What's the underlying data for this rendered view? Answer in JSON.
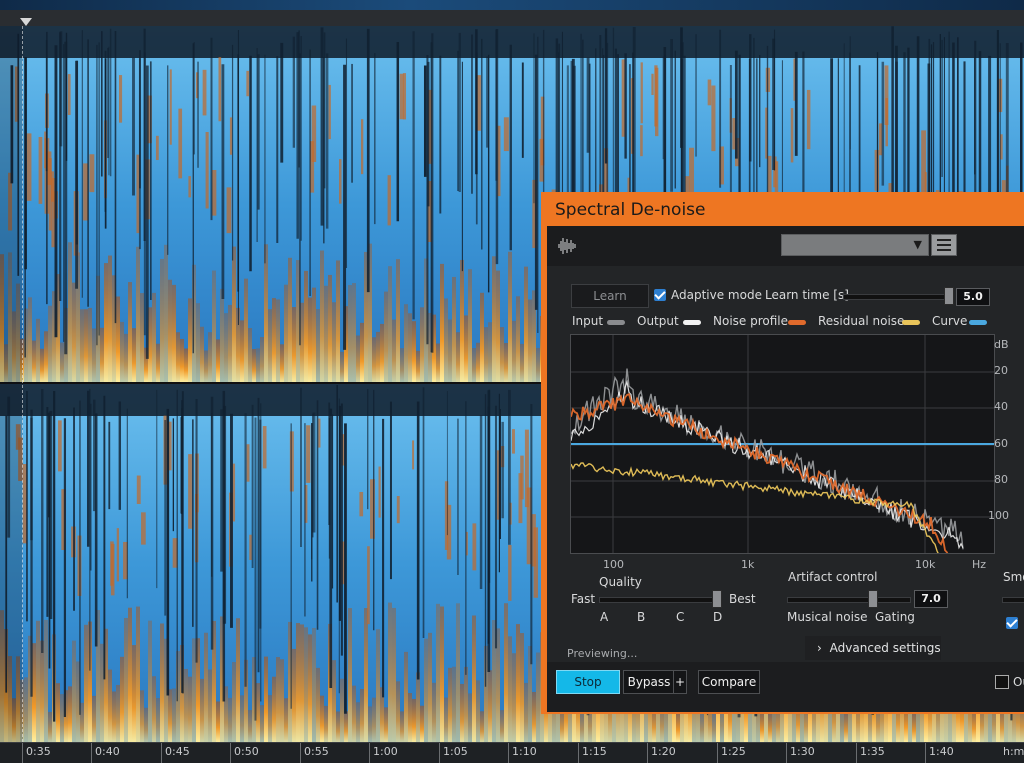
{
  "plugin": {
    "title": "Spectral De-noise",
    "learn_label": "Learn",
    "adaptive_label": "Adaptive mode",
    "learn_time_label": "Learn time [s]",
    "learn_time_value": "5.0",
    "legend": [
      {
        "label": "Input",
        "color": "#8a8c8f"
      },
      {
        "label": "Output",
        "color": "#f2f2f2"
      },
      {
        "label": "Noise profile",
        "color": "#e06a2c"
      },
      {
        "label": "Residual noise",
        "color": "#e9c45a"
      },
      {
        "label": "Curve",
        "color": "#4aa8e0"
      }
    ],
    "db_unit": "dB",
    "db_ticks": [
      "20",
      "40",
      "60",
      "80",
      "100"
    ],
    "hz_ticks": [
      "100",
      "1k",
      "10k",
      "Hz"
    ],
    "quality_label": "Quality",
    "fast_label": "Fast",
    "best_label": "Best",
    "quality_marks": [
      "A",
      "B",
      "C",
      "D"
    ],
    "artifact_label": "Artifact control",
    "artifact_value": "7.0",
    "musical_noise_label": "Musical noise",
    "gating_label": "Gating",
    "smoothing_label": "Smo",
    "previewing_text": "Previewing...",
    "advanced_label": "Advanced settings",
    "stop_label": "Stop",
    "bypass_label": "Bypass",
    "plus_label": "+",
    "compare_label": "Compare",
    "output_partial_label": "Ou"
  },
  "timeline": {
    "ticks": [
      "0:35",
      "0:40",
      "0:45",
      "0:50",
      "0:55",
      "1:00",
      "1:05",
      "1:10",
      "1:15",
      "1:20",
      "1:25",
      "1:30",
      "1:35",
      "1:40",
      "h:m"
    ]
  },
  "colors": {
    "accent": "#ee7622",
    "stop_button": "#14b8e8",
    "spectrogram_bg": "#4aa3df",
    "spectrogram_hot": "#f08a20"
  },
  "icons": [
    "waveform-icon",
    "chevron-down-icon",
    "menu-icon",
    "checkbox-icon",
    "chevron-right-icon"
  ]
}
